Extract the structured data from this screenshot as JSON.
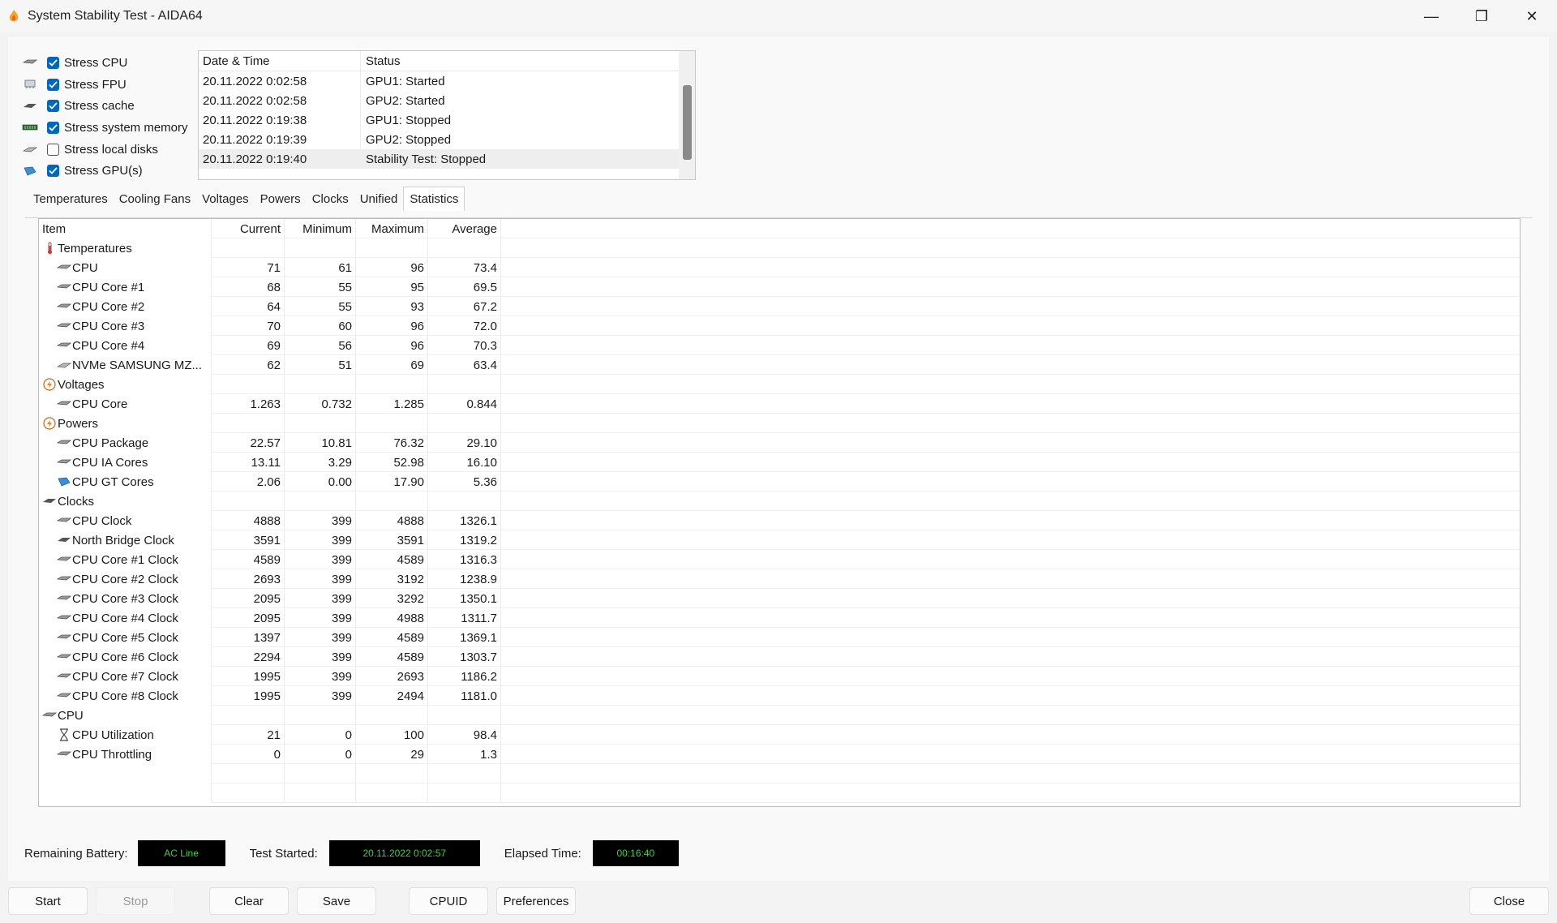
{
  "window": {
    "title": "System Stability Test - AIDA64",
    "minimize_glyph": "—",
    "restore_glyph": "❐",
    "close_glyph": "✕"
  },
  "stress_options": [
    {
      "label": "Stress CPU",
      "checked": true,
      "icon": "cpu-chip-icon"
    },
    {
      "label": "Stress FPU",
      "checked": true,
      "icon": "fpu-icon"
    },
    {
      "label": "Stress cache",
      "checked": true,
      "icon": "cache-icon"
    },
    {
      "label": "Stress system memory",
      "checked": true,
      "icon": "memory-icon"
    },
    {
      "label": "Stress local disks",
      "checked": false,
      "icon": "disk-icon"
    },
    {
      "label": "Stress GPU(s)",
      "checked": true,
      "icon": "gpu-icon"
    }
  ],
  "log": {
    "headers": {
      "datetime": "Date & Time",
      "status": "Status"
    },
    "rows": [
      {
        "datetime": "20.11.2022 0:02:58",
        "status": "GPU1: Started"
      },
      {
        "datetime": "20.11.2022 0:02:58",
        "status": "GPU2: Started"
      },
      {
        "datetime": "20.11.2022 0:19:38",
        "status": "GPU1: Stopped"
      },
      {
        "datetime": "20.11.2022 0:19:39",
        "status": "GPU2: Stopped"
      },
      {
        "datetime": "20.11.2022 0:19:40",
        "status": "Stability Test: Stopped"
      }
    ]
  },
  "tabs": {
    "items": [
      "Temperatures",
      "Cooling Fans",
      "Voltages",
      "Powers",
      "Clocks",
      "Unified",
      "Statistics"
    ],
    "active": "Statistics"
  },
  "stats": {
    "headers": {
      "item": "Item",
      "current": "Current",
      "minimum": "Minimum",
      "maximum": "Maximum",
      "average": "Average"
    },
    "rows": [
      {
        "group": true,
        "icon": "thermometer-icon",
        "item": "Temperatures"
      },
      {
        "icon": "cpu-chip-icon",
        "item": "CPU",
        "current": "71",
        "minimum": "61",
        "maximum": "96",
        "average": "73.4"
      },
      {
        "icon": "cpu-chip-icon",
        "item": "CPU Core #1",
        "current": "68",
        "minimum": "55",
        "maximum": "95",
        "average": "69.5"
      },
      {
        "icon": "cpu-chip-icon",
        "item": "CPU Core #2",
        "current": "64",
        "minimum": "55",
        "maximum": "93",
        "average": "67.2"
      },
      {
        "icon": "cpu-chip-icon",
        "item": "CPU Core #3",
        "current": "70",
        "minimum": "60",
        "maximum": "96",
        "average": "72.0"
      },
      {
        "icon": "cpu-chip-icon",
        "item": "CPU Core #4",
        "current": "69",
        "minimum": "56",
        "maximum": "96",
        "average": "70.3"
      },
      {
        "icon": "disk-icon",
        "item": "NVMe SAMSUNG MZ...",
        "current": "62",
        "minimum": "51",
        "maximum": "69",
        "average": "63.4"
      },
      {
        "group": true,
        "icon": "voltage-icon",
        "item": "Voltages"
      },
      {
        "icon": "cpu-chip-icon",
        "item": "CPU Core",
        "current": "1.263",
        "minimum": "0.732",
        "maximum": "1.285",
        "average": "0.844"
      },
      {
        "group": true,
        "icon": "power-icon",
        "item": "Powers"
      },
      {
        "icon": "cpu-chip-icon",
        "item": "CPU Package",
        "current": "22.57",
        "minimum": "10.81",
        "maximum": "76.32",
        "average": "29.10"
      },
      {
        "icon": "cpu-chip-icon",
        "item": "CPU IA Cores",
        "current": "13.11",
        "minimum": "3.29",
        "maximum": "52.98",
        "average": "16.10"
      },
      {
        "icon": "gpu-icon",
        "item": "CPU GT Cores",
        "current": "2.06",
        "minimum": "0.00",
        "maximum": "17.90",
        "average": "5.36"
      },
      {
        "group": true,
        "icon": "clock-chip-icon",
        "item": "Clocks"
      },
      {
        "icon": "cpu-chip-icon",
        "item": "CPU Clock",
        "current": "4888",
        "minimum": "399",
        "maximum": "4888",
        "average": "1326.1"
      },
      {
        "icon": "northbridge-icon",
        "item": "North Bridge Clock",
        "current": "3591",
        "minimum": "399",
        "maximum": "3591",
        "average": "1319.2"
      },
      {
        "icon": "cpu-chip-icon",
        "item": "CPU Core #1 Clock",
        "current": "4589",
        "minimum": "399",
        "maximum": "4589",
        "average": "1316.3"
      },
      {
        "icon": "cpu-chip-icon",
        "item": "CPU Core #2 Clock",
        "current": "2693",
        "minimum": "399",
        "maximum": "3192",
        "average": "1238.9"
      },
      {
        "icon": "cpu-chip-icon",
        "item": "CPU Core #3 Clock",
        "current": "2095",
        "minimum": "399",
        "maximum": "3292",
        "average": "1350.1"
      },
      {
        "icon": "cpu-chip-icon",
        "item": "CPU Core #4 Clock",
        "current": "2095",
        "minimum": "399",
        "maximum": "4988",
        "average": "1311.7"
      },
      {
        "icon": "cpu-chip-icon",
        "item": "CPU Core #5 Clock",
        "current": "1397",
        "minimum": "399",
        "maximum": "4589",
        "average": "1369.1"
      },
      {
        "icon": "cpu-chip-icon",
        "item": "CPU Core #6 Clock",
        "current": "2294",
        "minimum": "399",
        "maximum": "4589",
        "average": "1303.7"
      },
      {
        "icon": "cpu-chip-icon",
        "item": "CPU Core #7 Clock",
        "current": "1995",
        "minimum": "399",
        "maximum": "2693",
        "average": "1186.2"
      },
      {
        "icon": "cpu-chip-icon",
        "item": "CPU Core #8 Clock",
        "current": "1995",
        "minimum": "399",
        "maximum": "2494",
        "average": "1181.0"
      },
      {
        "group": true,
        "icon": "cpu-chip-icon",
        "item": "CPU"
      },
      {
        "icon": "hourglass-icon",
        "item": "CPU Utilization",
        "current": "21",
        "minimum": "0",
        "maximum": "100",
        "average": "98.4"
      },
      {
        "icon": "cpu-chip-icon",
        "item": "CPU Throttling",
        "current": "0",
        "minimum": "0",
        "maximum": "29",
        "average": "1.3"
      }
    ]
  },
  "info": {
    "battery_label": "Remaining Battery:",
    "battery_value": "AC Line",
    "started_label": "Test Started:",
    "started_value": "20.11.2022 0:02:57",
    "elapsed_label": "Elapsed Time:",
    "elapsed_value": "00:16:40"
  },
  "buttons": {
    "start": "Start",
    "stop": "Stop",
    "clear": "Clear",
    "save": "Save",
    "cpuid": "CPUID",
    "preferences": "Preferences",
    "close": "Close"
  },
  "colors": {
    "checkbox_accent": "#0067c0",
    "lcd_background": "#000000",
    "lcd_text": "#3fd13f"
  }
}
